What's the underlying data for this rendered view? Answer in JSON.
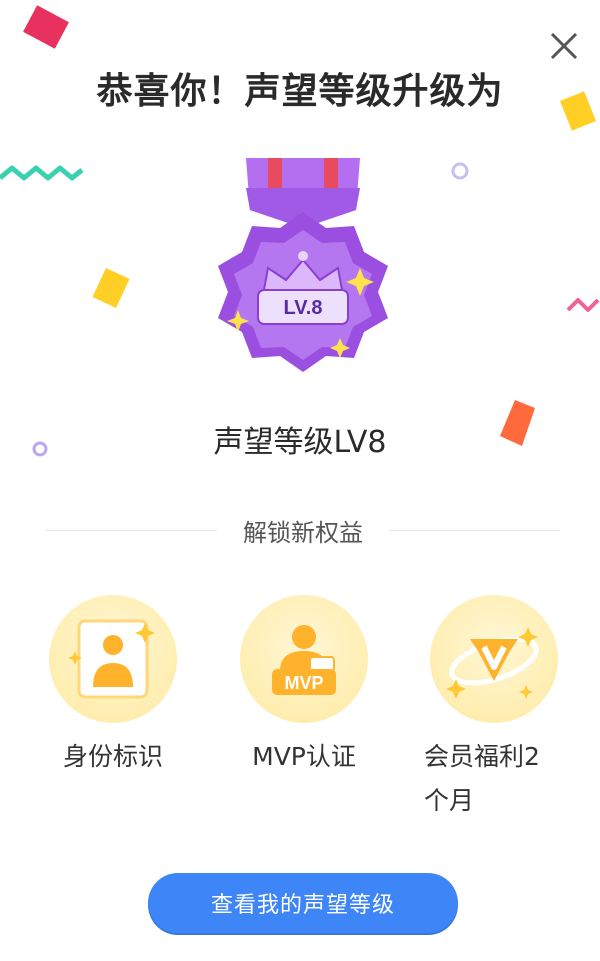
{
  "dialog": {
    "title": "恭喜你！声望等级升级为",
    "close_icon": "close-icon"
  },
  "medal": {
    "badge_text": "LV.8",
    "level_name": "声望等级LV8",
    "primary_color": "#9b4fe0",
    "ribbon_colors": [
      "#b46ef0",
      "#e84a5f"
    ]
  },
  "perks_section": {
    "heading": "解锁新权益",
    "items": [
      {
        "label": "身份标识",
        "icon": "identity-badge-icon"
      },
      {
        "label": "MVP认证",
        "icon": "mvp-badge-icon",
        "badge_text": "MVP"
      },
      {
        "label": "会员福利2个月",
        "icon": "vip-v-icon"
      }
    ]
  },
  "action": {
    "button_label": "查看我的声望等级",
    "button_color": "#3e86f7"
  },
  "confetti_colors": [
    "#e8315f",
    "#ffcf26",
    "#ff6a3d",
    "#3ad1b0",
    "#b9a7f0",
    "#f06292"
  ]
}
